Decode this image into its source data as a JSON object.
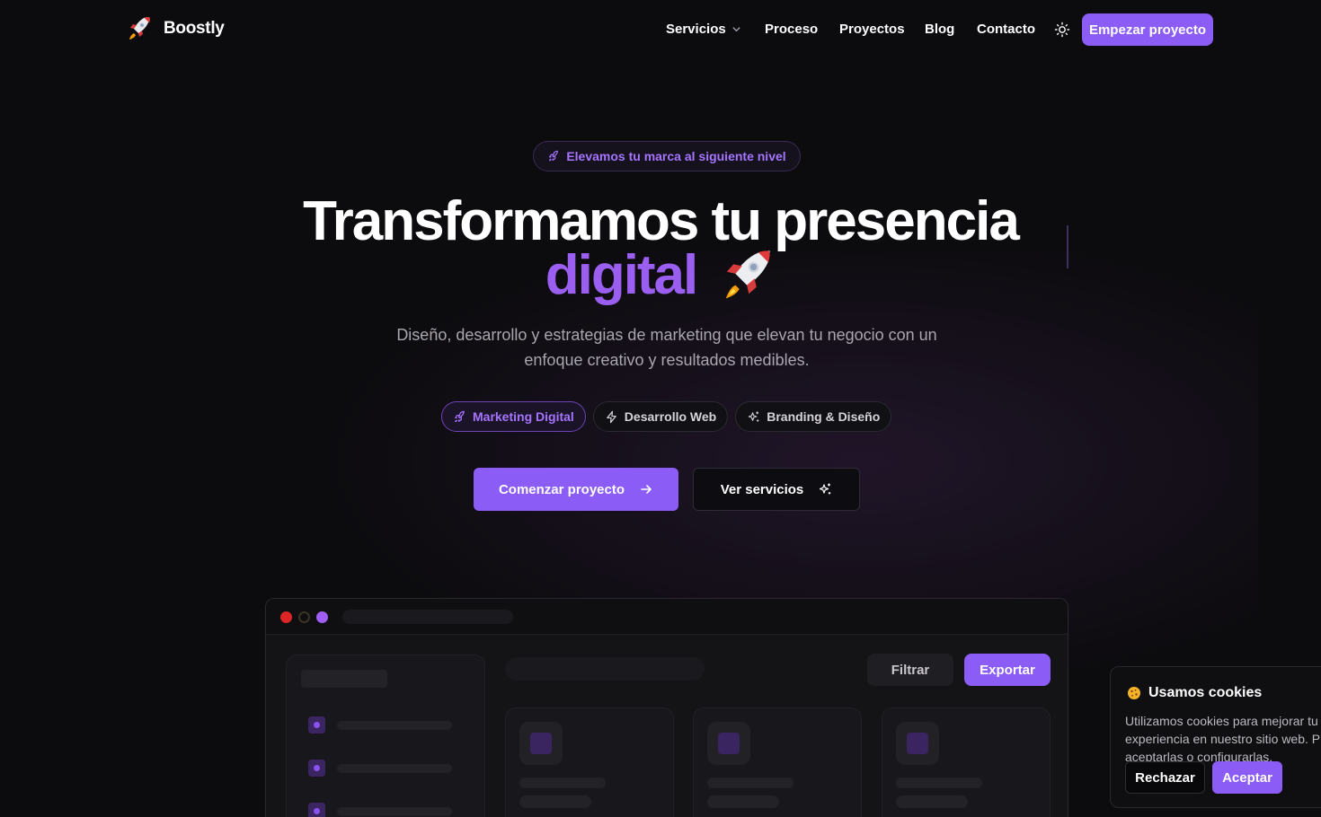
{
  "nav": {
    "brand": "Boostly",
    "logo_icon": "rocket-icon",
    "items": [
      "Servicios",
      "Proceso",
      "Proyectos",
      "Blog",
      "Contacto"
    ],
    "theme_icon": "sun-icon",
    "cta": "Empezar proyecto"
  },
  "hero": {
    "badge": "Elevamos tu marca al siguiente nivel",
    "title_line1": "Transformamos tu presencia",
    "title_accent": "digital",
    "subtitle_line1": "Diseño, desarrollo y estrategias de marketing que elevan tu negocio con un",
    "subtitle_line2": "enfoque creativo y resultados medibles.",
    "tags": [
      {
        "label": "Marketing Digital",
        "icon": "rocket-icon",
        "active": true
      },
      {
        "label": "Desarrollo Web",
        "icon": "zap-icon",
        "active": false
      },
      {
        "label": "Branding & Diseño",
        "icon": "sparkles-icon",
        "active": false
      }
    ],
    "primary_cta": "Comenzar proyecto",
    "secondary_cta": "Ver servicios"
  },
  "mockup": {
    "filter_label": "Filtrar",
    "export_label": "Exportar"
  },
  "cookie": {
    "title": "Usamos cookies",
    "body": "Utilizamos cookies para mejorar tu experiencia en nuestro sitio web. Puedes aceptarlas o configurarlas.",
    "reject": "Rechazar",
    "accept": "Aceptar"
  },
  "colors": {
    "accent": "#8b5cf6",
    "background": "#0c0b0e"
  }
}
